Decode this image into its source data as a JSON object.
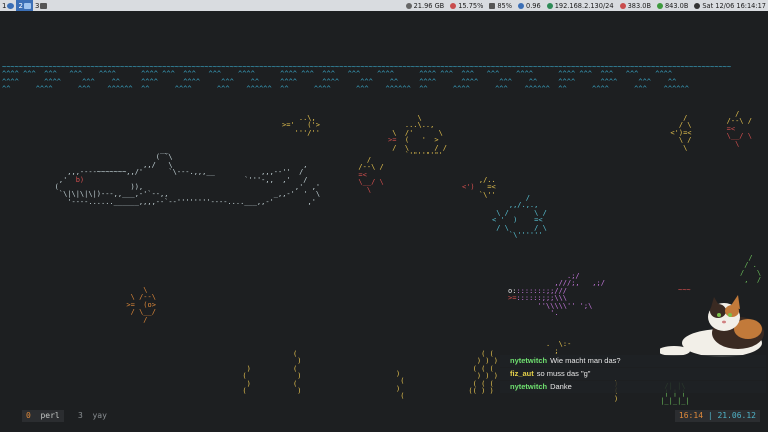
{
  "topbar": {
    "workspaces": [
      {
        "num": "1",
        "icon": "terminal-icon",
        "active": false
      },
      {
        "num": "2",
        "icon": "desktop-icon",
        "active": true
      },
      {
        "num": "3",
        "icon": "window-icon",
        "active": false
      }
    ],
    "status": {
      "disk": "21.96 GB",
      "cpu": "15.75%",
      "volume": "85%",
      "load": "0.96",
      "ip": "192.168.2.130/24",
      "download": "383.0B",
      "upload": "843.0B",
      "datetime": "Sat 12/06 16:14:17"
    }
  },
  "chat": {
    "messages": [
      {
        "nick": "nytetwitch",
        "nick_color": "#6fe06f",
        "text": "Wie macht man das?"
      },
      {
        "nick": "fiz_aut",
        "nick_color": "#e6d24a",
        "text": "so muss das \"g\""
      },
      {
        "nick": "nytetwitch",
        "nick_color": "#6fe06f",
        "text": "Danke"
      }
    ]
  },
  "tmux": {
    "windows": [
      {
        "index": "0",
        "name": "perl",
        "active": true
      },
      {
        "index": "3",
        "name": "yay",
        "active": false
      }
    ],
    "time": "16:14",
    "date": "21.06.12"
  },
  "colors": {
    "background": "#1d1f21",
    "water": "#3aa6c6",
    "accent": "#3b6fb6"
  }
}
